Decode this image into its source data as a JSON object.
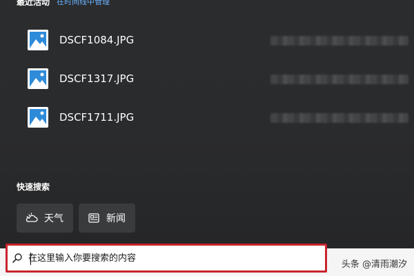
{
  "recent": {
    "title": "最近活动",
    "manage_link": "在时间线中管理",
    "items": [
      {
        "name": "DSCF1084.JPG",
        "icon": "image-file-icon"
      },
      {
        "name": "DSCF1317.JPG",
        "icon": "image-file-icon"
      },
      {
        "name": "DSCF1711.JPG",
        "icon": "image-file-icon"
      }
    ]
  },
  "quick_search": {
    "title": "快速搜索",
    "chips": [
      {
        "label": "天气",
        "icon": "weather-icon"
      },
      {
        "label": "新闻",
        "icon": "news-icon"
      }
    ]
  },
  "search": {
    "placeholder": "在这里输入你要搜索的内容",
    "icon": "search-icon"
  },
  "watermark": "头条 @清雨潮汐",
  "colors": {
    "accent_link": "#6ab3ff",
    "highlight_border": "#c8232c",
    "panel_bg": "#2b2c2e",
    "chip_bg": "#3a3b3d",
    "icon_blue": "#2e8bd9"
  }
}
